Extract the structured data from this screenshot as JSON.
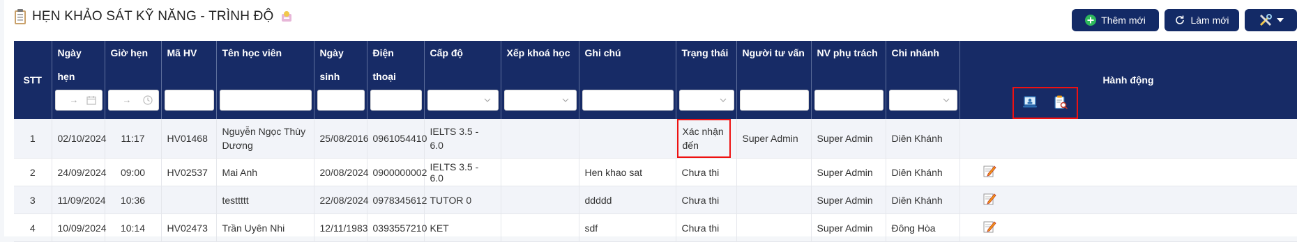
{
  "header": {
    "title": "HẸN KHẢO SÁT KỸ NĂNG - TRÌNH ĐỘ",
    "buttons": {
      "new": "Thêm mới",
      "refresh": "Làm mới"
    }
  },
  "table": {
    "columns": [
      "STT",
      "Ngày hẹn",
      "Giờ hẹn",
      "Mã HV",
      "Tên học viên",
      "Ngày sinh",
      "Điện thoại",
      "Cấp độ",
      "Xếp khoá học",
      "Ghi chú",
      "Trạng thái",
      "Người tư vấn",
      "NV phụ trách",
      "Chi nhánh",
      "Hành động"
    ],
    "rows": [
      {
        "stt": "1",
        "date": "02/10/2024",
        "time": "11:17",
        "code": "HV01468",
        "name": "Nguyễn Ngọc Thùy Dương",
        "dob": "25/08/2016",
        "phone": "0961054410",
        "level": "IELTS 3.5 - 6.0",
        "course": "",
        "note": "",
        "status": "Xác nhận đến",
        "advisor": "Super Admin",
        "staff": "Super Admin",
        "branch": "Diên Khánh"
      },
      {
        "stt": "2",
        "date": "24/09/2024",
        "time": "09:00",
        "code": "HV02537",
        "name": "Mai Anh",
        "dob": "20/08/2024",
        "phone": "0900000002",
        "level": "IELTS 3.5 - 6.0",
        "course": "",
        "note": "Hen khao sat",
        "status": "Chưa thi",
        "advisor": "",
        "staff": "Super Admin",
        "branch": "Diên Khánh"
      },
      {
        "stt": "3",
        "date": "11/09/2024",
        "time": "10:36",
        "code": "",
        "name": "testtttt",
        "dob": "22/08/2024",
        "phone": "0978345612",
        "level": "TUTOR 0",
        "course": "",
        "note": "ddddd",
        "status": "Chưa thi",
        "advisor": "",
        "staff": "Super Admin",
        "branch": "Diên Khánh"
      },
      {
        "stt": "4",
        "date": "10/09/2024",
        "time": "10:14",
        "code": "HV02473",
        "name": "Trần Uyên Nhi",
        "dob": "12/11/1983",
        "phone": "0393557210",
        "level": "KET",
        "course": "",
        "note": "sdf",
        "status": "Chưa thi",
        "advisor": "",
        "staff": "Super Admin",
        "branch": "Đông Hòa"
      }
    ]
  },
  "icons": {
    "title": "clipboard-list-icon",
    "title_badge": "certificate-icon",
    "new": "plus-circle-icon",
    "refresh": "refresh-icon",
    "tools": "tools-icon",
    "date": "calendar-icon",
    "time": "clock-icon",
    "select": "chevron-down-icon",
    "row_action_1": "laptop-test-icon",
    "row_action_2": "clipboard-search-icon",
    "row_action_edit": "edit-note-icon"
  },
  "colors": {
    "header_bg": "#172b66",
    "button_bg": "#132a66",
    "plus": "#2eb85c",
    "highlight": "#e11111"
  }
}
